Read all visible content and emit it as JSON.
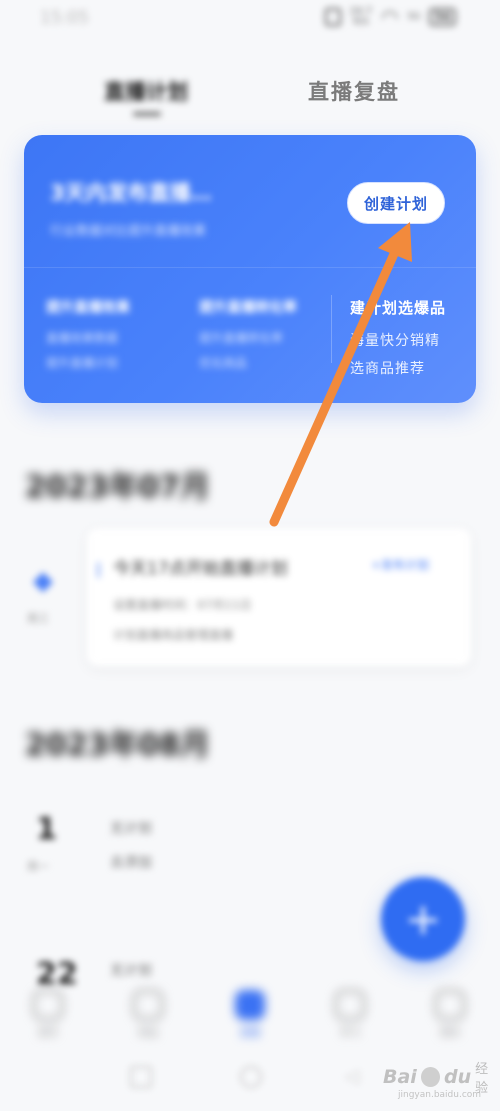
{
  "status_bar": {
    "time": "15:05",
    "net_speed": "24.7",
    "net_unit": "K/s",
    "signal": "5G",
    "battery": "56"
  },
  "tabs": {
    "active_label": "直播计划",
    "review_label": "直播复盘"
  },
  "plan_card": {
    "title": "3天内发布直播…",
    "subtitle": "行业数据对比提升直播效果",
    "create_button": "创建计划",
    "features": [
      {
        "title": "提升直播效果",
        "line1": "直播效果数据",
        "line2": "提升直播计划"
      },
      {
        "title": "提升直播转化率",
        "line1": "提升直播转化率",
        "line2": "优化商品"
      },
      {
        "title": "建计划选爆品",
        "line1": "海量快分销精",
        "line2": "选商品推荐"
      }
    ]
  },
  "timeline": {
    "month1": "2023年07月",
    "month2": "2023年08月",
    "plan_dot_label": "周三",
    "plan_item": {
      "title": "今天17点开始直播计划",
      "link": "+发布计划",
      "line1": "设置直播时间：07月11日",
      "line2": "计划直播商品管理直播"
    },
    "day1": "1",
    "day1_weekday": "周一",
    "day1_row1": "无计划",
    "day1_row2": "去添加",
    "day2": "22",
    "day2_row1": "无计划"
  },
  "fab": {
    "label": "+"
  },
  "bottom_nav": {
    "items": [
      {
        "label": "首页"
      },
      {
        "label": "商品"
      },
      {
        "label": "直播"
      },
      {
        "label": "学习"
      },
      {
        "label": "我的"
      }
    ]
  },
  "watermark": {
    "brand": "Bai",
    "brand2": "du",
    "cn": "经验",
    "url": "jingyan.baidu.com"
  },
  "colors": {
    "accent": "#3d76f5",
    "annotation_arrow": "#f28a3c"
  }
}
